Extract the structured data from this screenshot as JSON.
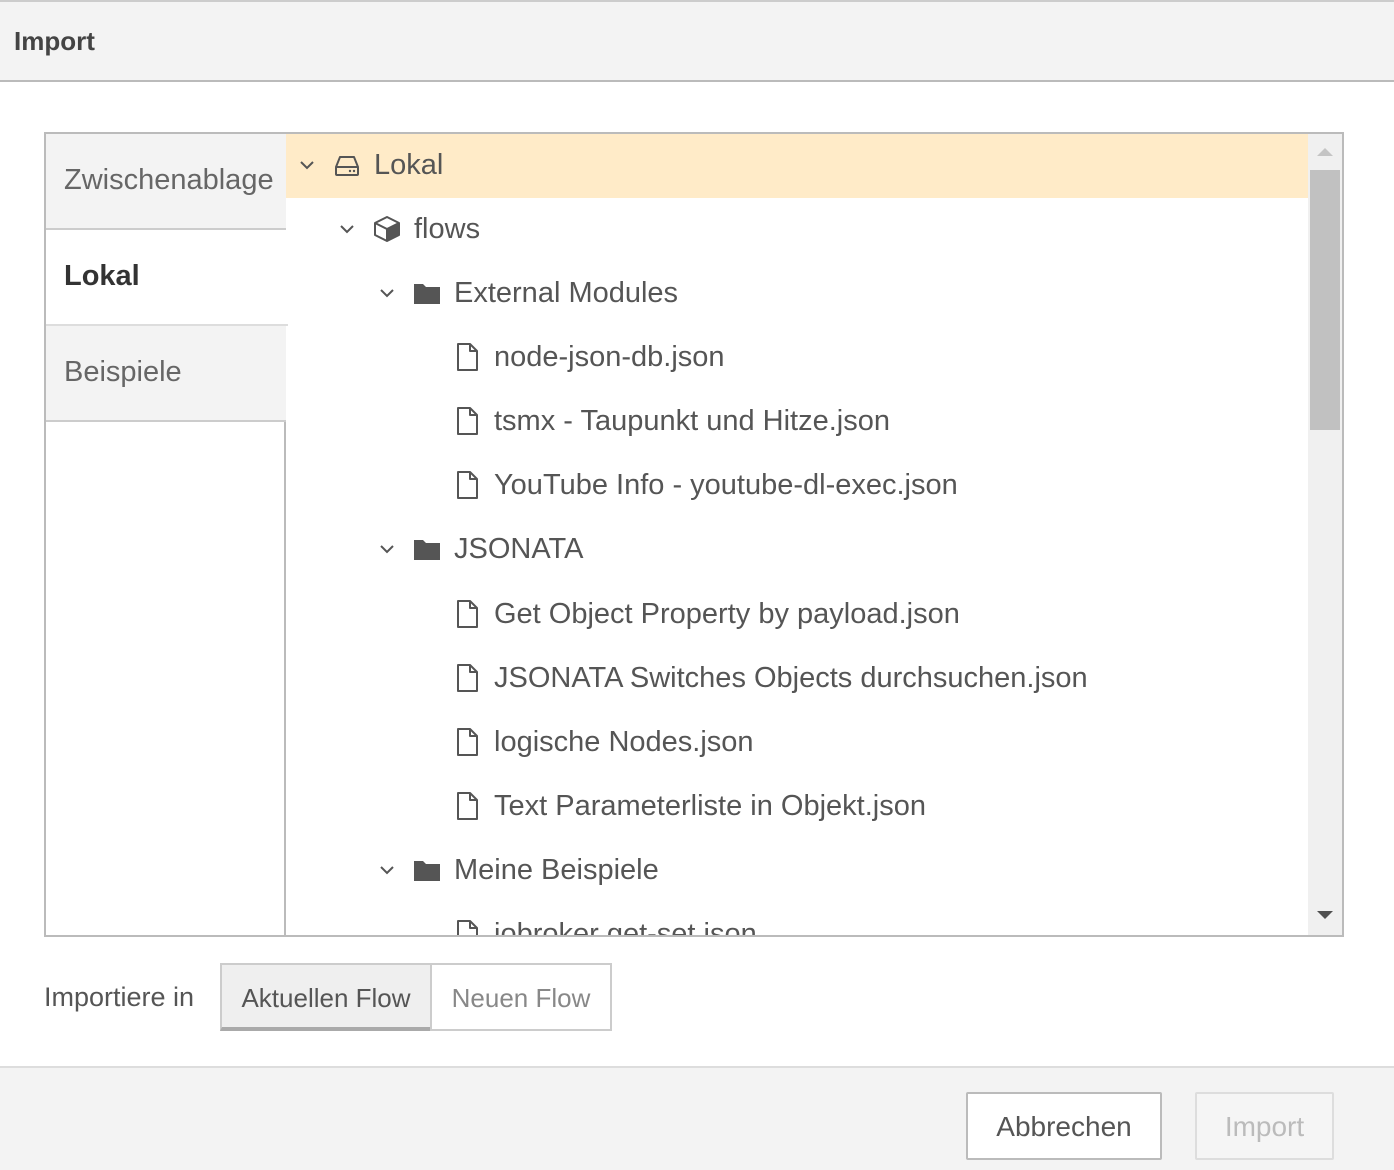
{
  "dialog": {
    "title": "Import"
  },
  "tabs": [
    {
      "label": "Zwischenablage",
      "active": false
    },
    {
      "label": "Lokal",
      "active": true
    },
    {
      "label": "Beispiele",
      "active": false
    }
  ],
  "tree": {
    "items": [
      {
        "label": "Lokal",
        "icon": "drive-icon",
        "expanded": true,
        "selected": true
      },
      {
        "label": "flows",
        "icon": "cube-icon",
        "expanded": true
      },
      {
        "label": "External Modules",
        "icon": "folder-icon",
        "expanded": true
      },
      {
        "label": "node-json-db.json",
        "icon": "file-icon"
      },
      {
        "label": "tsmx - Taupunkt und Hitze.json",
        "icon": "file-icon"
      },
      {
        "label": "YouTube Info - youtube-dl-exec.json",
        "icon": "file-icon"
      },
      {
        "label": "JSONATA",
        "icon": "folder-icon",
        "expanded": true
      },
      {
        "label": "Get Object Property by payload.json",
        "icon": "file-icon"
      },
      {
        "label": "JSONATA Switches Objects durchsuchen.json",
        "icon": "file-icon"
      },
      {
        "label": "logische Nodes.json",
        "icon": "file-icon"
      },
      {
        "label": "Text Parameterliste in Objekt.json",
        "icon": "file-icon"
      },
      {
        "label": "Meine Beispiele",
        "icon": "folder-icon",
        "expanded": true
      },
      {
        "label": "iobroker get-set.json",
        "icon": "file-icon"
      }
    ]
  },
  "import_target": {
    "label": "Importiere in",
    "options": [
      "Aktuellen Flow",
      "Neuen Flow"
    ],
    "selected": "Aktuellen Flow"
  },
  "footer": {
    "cancel_label": "Abbrechen",
    "import_label": "Import"
  },
  "colors": {
    "selected_row": "#ffebc8",
    "titlebar": "#f3f3f3"
  }
}
